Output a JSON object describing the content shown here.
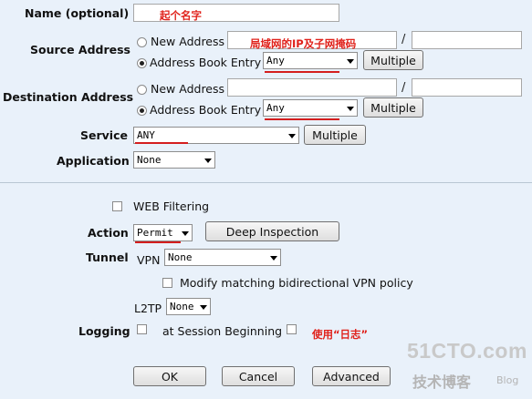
{
  "name": {
    "label": "Name (optional)",
    "note": "起个名字"
  },
  "source": {
    "label": "Source Address",
    "new_address": "New Address",
    "address_book": "Address Book Entry",
    "entry": "Any",
    "multiple": "Multiple",
    "note": "局域网的IP及子网掩码"
  },
  "destination": {
    "label": "Destination Address",
    "new_address": "New Address",
    "address_book": "Address Book Entry",
    "entry": "Any",
    "multiple": "Multiple"
  },
  "service": {
    "label": "Service",
    "value": "ANY",
    "multiple": "Multiple"
  },
  "application": {
    "label": "Application",
    "value": "None"
  },
  "web_filtering": {
    "label": "WEB Filtering"
  },
  "action": {
    "label": "Action",
    "value": "Permit",
    "deep_inspection": "Deep Inspection"
  },
  "tunnel": {
    "label": "Tunnel",
    "vpn_label": "VPN",
    "vpn_value": "None",
    "modify_label": "Modify matching bidirectional VPN policy",
    "l2tp_label": "L2TP",
    "l2tp_value": "None"
  },
  "logging": {
    "label": "Logging",
    "session_label": "at Session Beginning",
    "note": "使用“日志”"
  },
  "buttons": {
    "ok": "OK",
    "cancel": "Cancel",
    "advanced": "Advanced"
  },
  "watermark": {
    "site": "51CTO.com",
    "tagline": "技术博客",
    "blog": "Blog"
  },
  "colors": {
    "background": "#e9f1fa",
    "annotation": "#e0221b",
    "watermark": "#c9c9c9"
  }
}
